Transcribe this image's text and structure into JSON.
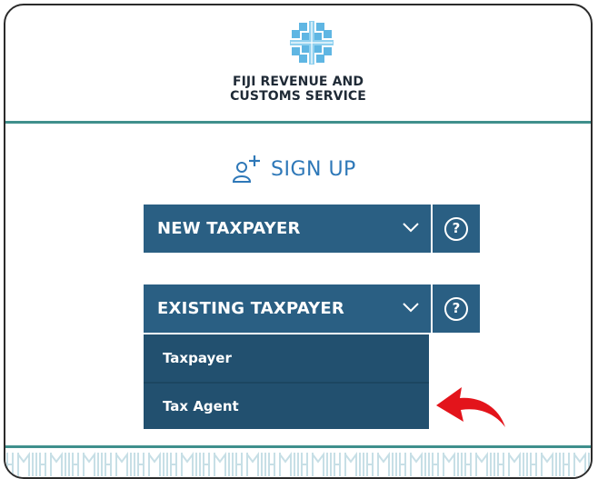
{
  "org": {
    "name_line1": "FIJI REVENUE AND",
    "name_line2": "CUSTOMS SERVICE",
    "logo_icon": "frcs-logo-icon"
  },
  "signup": {
    "icon": "add-user-icon",
    "label": "SIGN UP"
  },
  "dropdowns": [
    {
      "label": "NEW TAXPAYER",
      "chevron_icon": "chevron-down-icon",
      "help_icon": "question-icon",
      "help_label": "?"
    },
    {
      "label": "EXISTING TAXPAYER",
      "chevron_icon": "chevron-down-icon",
      "help_icon": "question-icon",
      "help_label": "?",
      "expanded": true
    }
  ],
  "existing_menu": {
    "items": [
      {
        "label": "Taxpayer"
      },
      {
        "label": "Tax Agent"
      }
    ]
  },
  "annotation": {
    "arrow_icon": "red-curved-arrow-icon",
    "arrow_color": "#e3141b"
  },
  "colors": {
    "primary_blue": "#2a5f83",
    "menu_blue": "#22506f",
    "teal_line": "#3f8f8c",
    "signup_blue": "#2e78b8"
  }
}
